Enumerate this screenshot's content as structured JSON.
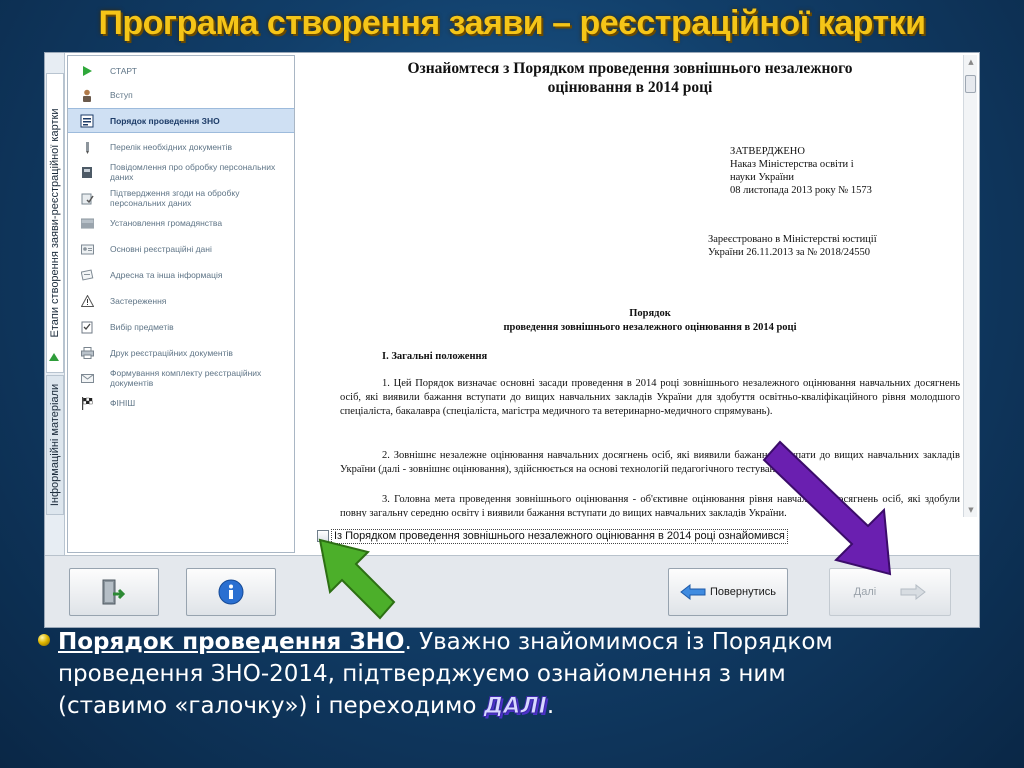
{
  "slide": {
    "title": "Програма створення заяви – реєстраційної картки",
    "caption": {
      "link_text": "Порядок проведення ЗНО",
      "after_link": ". Уважно знайомимося із Порядком",
      "line2": "проведення ЗНО-2014, підтверджуємо ознайомлення з ним",
      "line3_before": "(ставимо «галочку») і переходимо ",
      "next_word": "ДАЛІ",
      "line3_end": "."
    }
  },
  "app": {
    "vertical_tabs": [
      {
        "label": "Етапи створення заяви-реєстраційної картки",
        "active": true
      },
      {
        "label": "Інформаційні матеріали",
        "active": false
      }
    ],
    "sidebar": {
      "items": [
        {
          "label": "СТАРТ",
          "icon": "play-icon"
        },
        {
          "label": "Вступ",
          "icon": "person-icon"
        },
        {
          "label": "Порядок проведення ЗНО",
          "icon": "document-icon",
          "active": true
        },
        {
          "label": "Перелік необхідних документів",
          "icon": "pen-icon"
        },
        {
          "label": "Повідомлення про обробку персональних даних",
          "icon": "notebook-icon"
        },
        {
          "label": "Підтвердження згоди на обробку персональних даних",
          "icon": "consent-icon"
        },
        {
          "label": "Установлення громадянства",
          "icon": "flag-icon"
        },
        {
          "label": "Основні реєстраційні дані",
          "icon": "id-card-icon"
        },
        {
          "label": "Адресна та інша інформація",
          "icon": "address-icon"
        },
        {
          "label": "Застереження",
          "icon": "warning-icon"
        },
        {
          "label": "Вибір предметів",
          "icon": "checklist-icon"
        },
        {
          "label": "Друк реєстраційних документів",
          "icon": "printer-icon"
        },
        {
          "label": "Формування комплекту реєстраційних документів",
          "icon": "envelope-icon"
        },
        {
          "label": "ФІНІШ",
          "icon": "finish-flag-icon"
        }
      ]
    },
    "document": {
      "title_line1": "Ознайомтеся з Порядком проведення зовнішнього незалежного",
      "title_line2": "оцінювання в 2014 році",
      "approved": [
        "ЗАТВЕРДЖЕНО",
        "Наказ Міністерства освіти і",
        "науки України",
        "08 листопада 2013 року № 1573"
      ],
      "registered": [
        "Зареєстровано в Міністерстві юстиції",
        "України 26.11.2013 за № 2018/24550"
      ],
      "heading1": "Порядок",
      "heading2": "проведення зовнішнього незалежного оцінювання в 2014 році",
      "section": "I. Загальні положення",
      "p1": "1. Цей Порядок визначає основні засади проведення в 2014 році зовнішнього незалежного оцінювання навчальних досягнень осіб, які виявили бажання вступати до вищих навчальних закладів України для здобуття освітньо-кваліфікаційного рівня молодшого спеціаліста, бакалавра (спеціаліста, магістра медичного та ветеринарно-медичного спрямувань).",
      "p2": "2. Зовнішнє незалежне оцінювання навчальних досягнень осіб, які виявили бажання вступати до вищих навчальних закладів України (далі - зовнішнє оцінювання), здійснюється на основі технологій педагогічного тестування.",
      "p3": "3. Головна мета проведення зовнішнього оцінювання - об'єктивне оцінювання рівня навчальних досягнень осіб, які здобули повну загальну середню освіту і виявили бажання вступати до вищих навчальних закладів України."
    },
    "checkbox": {
      "label": "Із Порядком проведення зовнішнього незалежного оцінювання в 2014 році ознайомився",
      "checked": false
    },
    "buttons": {
      "exit_icon": "exit-door-icon",
      "info_icon": "info-icon",
      "back_label": "Повернутись",
      "next_label": "Далі"
    }
  },
  "colors": {
    "title": "#f5c518",
    "active_item": "#cfe0f3",
    "annotation_green": "#4caf2a",
    "annotation_purple": "#6a1fb0"
  }
}
